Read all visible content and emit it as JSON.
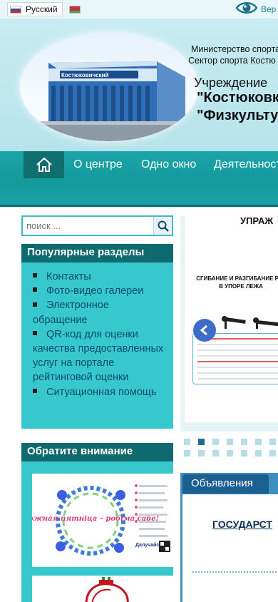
{
  "topbar": {
    "language_label": "Русский",
    "vision_text": "Вер"
  },
  "header": {
    "ministry_line": "Министерство спорта",
    "sector_line": "Сектор спорта Костю",
    "institution_line1": "Учреждение",
    "institution_line2": "\"Костюковк",
    "institution_line3": "\"Физкульту",
    "building_sign": "Костюковичский"
  },
  "nav": {
    "items": [
      {
        "label": "О центре"
      },
      {
        "label": "Одно окно"
      },
      {
        "label": "Деятельност"
      }
    ]
  },
  "search": {
    "placeholder": "поиск ..."
  },
  "popular": {
    "title": "Популярные разделы",
    "items": [
      {
        "label": "Контакты"
      },
      {
        "label": "Фото-видео галереи"
      },
      {
        "label": "Электронное обращение"
      },
      {
        "label": "QR-код для оценки качества предоставленных услуг на портале рейтинговой оценки"
      },
      {
        "label": "Ситуационная помощь"
      }
    ]
  },
  "attention": {
    "title": "Обратите внимание",
    "banner_text": "Кожная пятніца – робіма сабе!",
    "banner_call": "Далучайся!"
  },
  "slider": {
    "title": "УПРАЖ",
    "subtitle": "СГИБАНИЕ И РАЗГИБАНИЕ РУК В УПОРЕ ЛЕЖА",
    "active_index": 1
  },
  "announcements": {
    "tab_label": "Объявления",
    "link_text": "ГОСУДАРСТ"
  },
  "colors": {
    "nav": "#1ba5a8",
    "panel": "#36c8cc",
    "panel_head": "#0e6a6e",
    "link": "#0d4d6b",
    "announcement": "#1c5f91"
  }
}
